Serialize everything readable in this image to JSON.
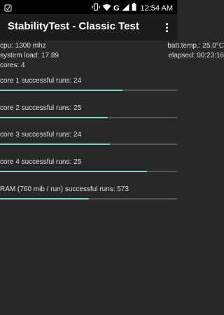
{
  "status": {
    "time": "12:54 AM",
    "network": "G",
    "icons": [
      "notification-icon",
      "vibrate-icon",
      "wifi-icon",
      "signal-icon",
      "battery-icon"
    ]
  },
  "app": {
    "title": "StabilityTest - Classic Test",
    "menu_icon": "more-vert-icon"
  },
  "info": {
    "cpu": "cpu: 1300 mhz",
    "batt_temp": "batt.temp.: 25.0°C",
    "system_load": "system load: 17.89",
    "elapsed": "elapsed: 00:23:16",
    "cores": "cores: 4"
  },
  "rows": [
    {
      "label": "core 1 successful runs: 24",
      "progress": 0.69
    },
    {
      "label": "core 2 successful runs: 25",
      "progress": 0.61
    },
    {
      "label": "core 3 successful runs: 24",
      "progress": 0.62
    },
    {
      "label": "core 4 successful runs: 25",
      "progress": 0.83
    },
    {
      "label": "RAM (760 mib / run) successful runs: 573",
      "progress": 0.5
    }
  ],
  "colors": {
    "accent": "#7fd3c8",
    "track": "#555555",
    "background": "#282828",
    "appbar": "#1b1b1b"
  }
}
